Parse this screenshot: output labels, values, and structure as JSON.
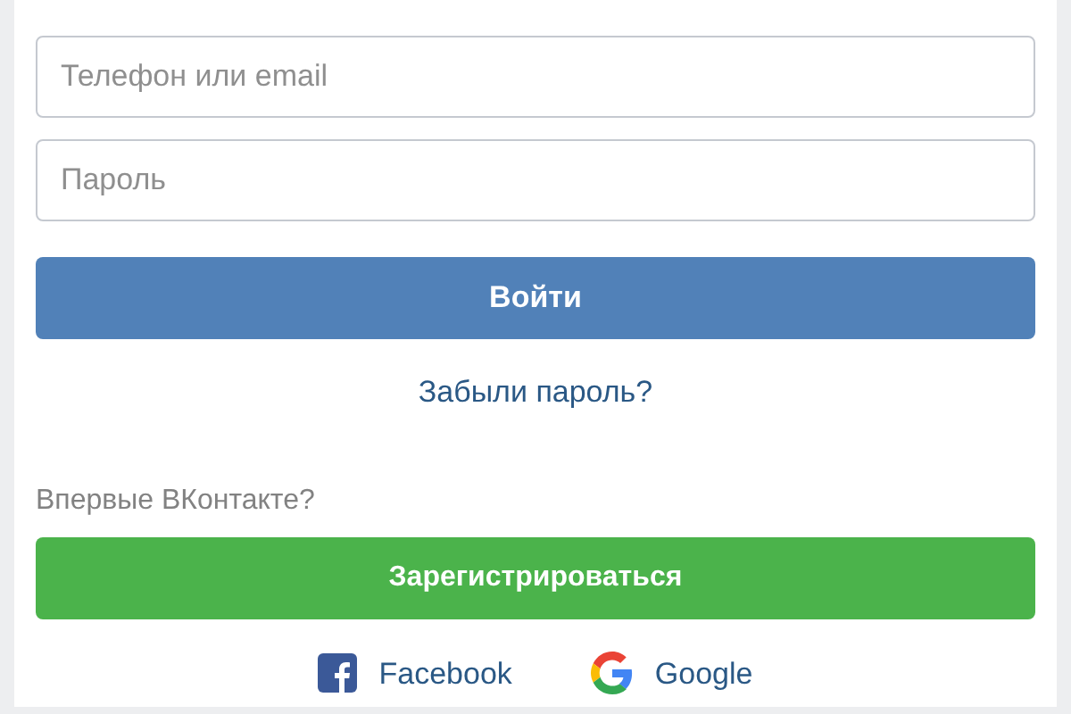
{
  "login_field": {
    "placeholder": "Телефон или email"
  },
  "password_field": {
    "placeholder": "Пароль"
  },
  "login_button": "Войти",
  "forgot_link": "Забыли пароль?",
  "signup_prompt": "Впервые ВКонтакте?",
  "signup_button": "Зарегистрироваться",
  "social_logins": [
    {
      "kind": "facebook",
      "label": "Facebook"
    },
    {
      "kind": "google",
      "label": "Google"
    }
  ]
}
